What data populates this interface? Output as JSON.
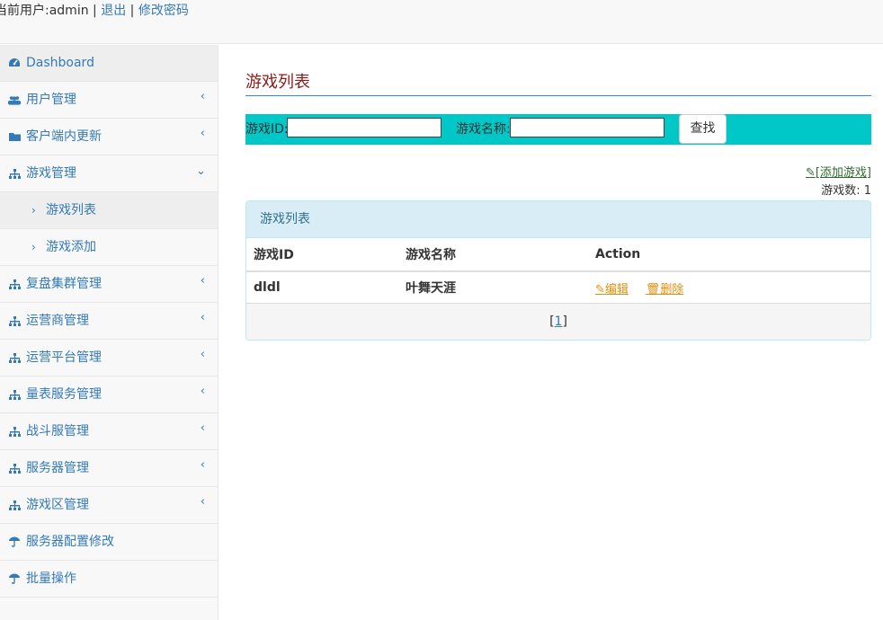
{
  "header": {
    "user_prefix": "当前用户:admin",
    "sep1": " | ",
    "logout": "退出",
    "sep2": " | ",
    "change_password": "修改密码"
  },
  "sidebar": {
    "items": [
      {
        "label": "Dashboard",
        "icon": "dashboard-icon"
      },
      {
        "label": "用户管理",
        "icon": "users-icon"
      },
      {
        "label": "客户端内更新",
        "icon": "folder-icon"
      },
      {
        "label": "游戏管理",
        "icon": "sitemap-icon"
      },
      {
        "label": "游戏列表"
      },
      {
        "label": "游戏添加"
      },
      {
        "label": "复盘集群管理",
        "icon": "sitemap-icon"
      },
      {
        "label": "运营商管理",
        "icon": "sitemap-icon"
      },
      {
        "label": "运营平台管理",
        "icon": "sitemap-icon"
      },
      {
        "label": "量表服务管理",
        "icon": "sitemap-icon"
      },
      {
        "label": "战斗服管理",
        "icon": "sitemap-icon"
      },
      {
        "label": "服务器管理",
        "icon": "sitemap-icon"
      },
      {
        "label": "游戏区管理",
        "icon": "sitemap-icon"
      },
      {
        "label": "服务器配置修改",
        "icon": "umbrella-icon"
      },
      {
        "label": "批量操作",
        "icon": "umbrella-icon"
      }
    ]
  },
  "main": {
    "title": "游戏列表",
    "search": {
      "game_id_label": "游戏ID:",
      "game_id_value": "",
      "game_name_label": "游戏名称:",
      "game_name_value": "",
      "button": "查找"
    },
    "add_link": "[添加游戏]",
    "count_label": "游戏数: 1",
    "panel_title": "游戏列表",
    "table": {
      "headers": [
        "游戏ID",
        "游戏名称",
        "Action"
      ],
      "rows": [
        {
          "id": "dldl",
          "name": "叶舞天涯",
          "edit": "编辑",
          "delete": "删除"
        }
      ]
    },
    "pagination": {
      "open": "[",
      "page": "1",
      "close": "]"
    }
  },
  "colors": {
    "search_bar": "#00c8c8",
    "link": "#337ab7",
    "title": "#8b1a1a",
    "action": "#e08e0b"
  }
}
